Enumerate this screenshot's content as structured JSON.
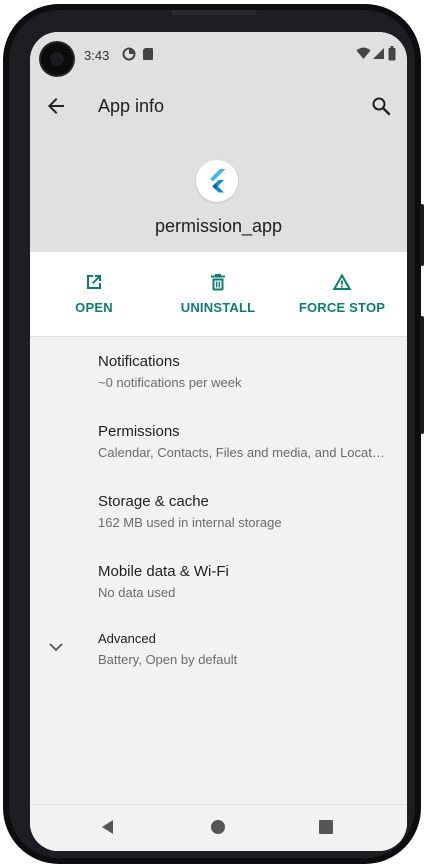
{
  "status_bar": {
    "time": "3:43",
    "icons": [
      "data-saver-icon",
      "sd-card-icon",
      "wifi-icon",
      "signal-icon",
      "battery-icon"
    ]
  },
  "app_bar": {
    "title": "App info",
    "back_icon": "arrow-back-icon",
    "search_icon": "search-icon"
  },
  "app_header": {
    "icon": "flutter-logo-icon",
    "name": "permission_app"
  },
  "actions": [
    {
      "label": "OPEN",
      "icon": "open-in-new-icon"
    },
    {
      "label": "UNINSTALL",
      "icon": "trash-icon"
    },
    {
      "label": "FORCE STOP",
      "icon": "warning-icon"
    }
  ],
  "settings": [
    {
      "title": "Notifications",
      "summary": "~0 notifications per week"
    },
    {
      "title": "Permissions",
      "summary": "Calendar, Contacts, Files and media, and Locat…"
    },
    {
      "title": "Storage & cache",
      "summary": "162 MB used in internal storage"
    },
    {
      "title": "Mobile data & Wi-Fi",
      "summary": "No data used"
    },
    {
      "title": "Advanced",
      "summary": "Battery, Open by default",
      "icon": "chevron-down-icon"
    }
  ],
  "nav_bar": {
    "icons": [
      "back-triangle-icon",
      "home-circle-icon",
      "recents-square-icon"
    ]
  },
  "colors": {
    "accent": "#0b7f74",
    "header_bg": "#e0e0e0",
    "screen_bg": "#f2f2f2",
    "title_text": "#1f1f1f",
    "summary_text": "#6b6b6b"
  }
}
